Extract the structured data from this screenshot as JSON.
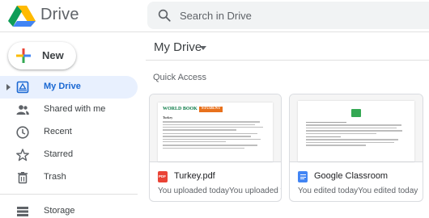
{
  "header": {
    "app_name": "Drive",
    "search_placeholder": "Search in Drive"
  },
  "sidebar": {
    "new_label": "New",
    "items": [
      {
        "label": "My Drive",
        "icon": "my-drive-icon",
        "active": true
      },
      {
        "label": "Shared with me",
        "icon": "people-icon",
        "active": false
      },
      {
        "label": "Recent",
        "icon": "clock-icon",
        "active": false
      },
      {
        "label": "Starred",
        "icon": "star-icon",
        "active": false
      },
      {
        "label": "Trash",
        "icon": "trash-icon",
        "active": false
      },
      {
        "label": "Storage",
        "icon": "storage-icon",
        "active": false
      }
    ]
  },
  "main": {
    "title": "My Drive",
    "section_title": "Quick Access",
    "files": [
      {
        "name": "Turkey.pdf",
        "meta": "You uploaded todayYou uploaded t",
        "type": "pdf",
        "type_color": "#ea4335",
        "type_label": "PDF"
      },
      {
        "name": "Google Classroom",
        "meta": "You edited todayYou edited today",
        "type": "doc",
        "type_color": "#4285f4"
      }
    ]
  },
  "thumbnails": {
    "turkey": {
      "banner_brand": "WORLD BOOK",
      "banner_tag": "STUDENT",
      "heading": "Turkey"
    }
  },
  "colors": {
    "accent": "#1967d2",
    "active_bg": "#e8f0fe",
    "search_bg": "#f1f3f4"
  }
}
